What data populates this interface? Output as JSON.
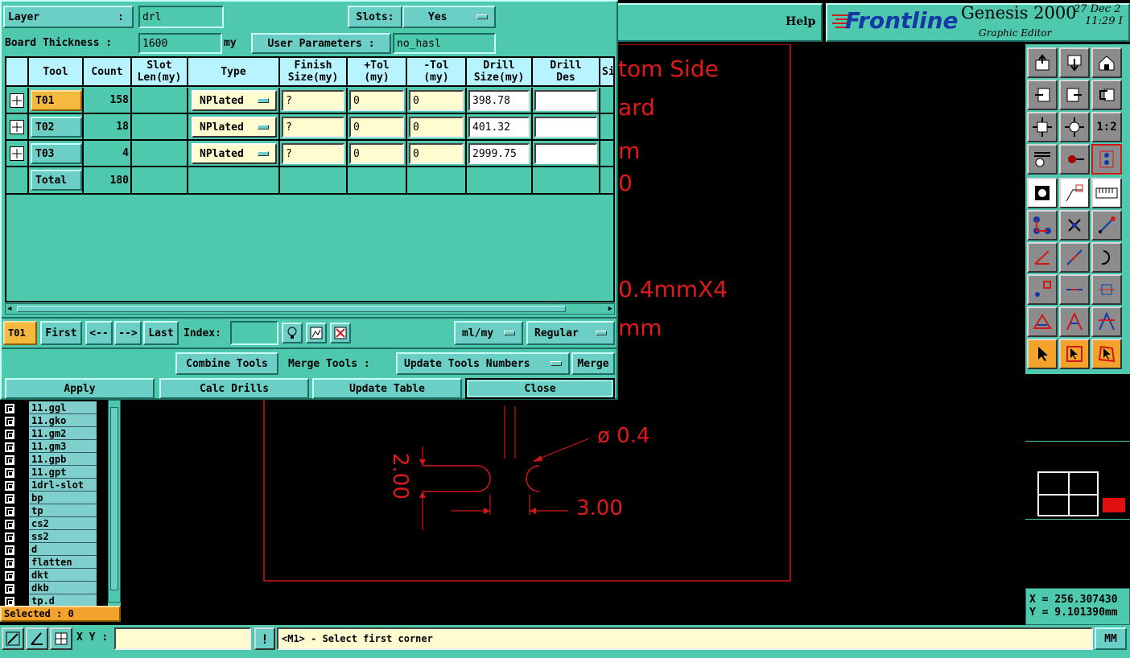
{
  "dialog": {
    "layer_label": "Layer",
    "layer_colon": ":",
    "layer_value": "drl",
    "slots_label": "Slots:",
    "slots_value": "Yes",
    "board_thickness_label": "Board Thickness :",
    "board_thickness_value": "1600",
    "board_thickness_unit": "my",
    "user_params_label": "User Parameters :",
    "user_params_value": "no_hasl",
    "columns": [
      "Tool",
      "Count",
      "Slot\nLen(my)",
      "Type",
      "Finish\nSize(my)",
      "+Tol\n(my)",
      "-Tol\n(my)",
      "Drill\nSize(my)",
      "Drill\nDes",
      "Si"
    ],
    "rows": [
      {
        "tool": "T01",
        "count": "158",
        "type": "NPlated",
        "finish": "?",
        "ptol": "0",
        "mtol": "0",
        "drill": "398.78",
        "des": ""
      },
      {
        "tool": "T02",
        "count": "18",
        "type": "NPlated",
        "finish": "?",
        "ptol": "0",
        "mtol": "0",
        "drill": "401.32",
        "des": ""
      },
      {
        "tool": "T03",
        "count": "4",
        "type": "NPlated",
        "finish": "?",
        "ptol": "0",
        "mtol": "0",
        "drill": "2999.75",
        "des": ""
      }
    ],
    "total_label": "Total",
    "total_count": "180",
    "nav": {
      "current": "T01",
      "first": "First",
      "prev": "<--",
      "next": "-->",
      "last": "Last",
      "index_label": "Index:",
      "units": "ml/my",
      "mode": "Regular"
    },
    "combine_tools": "Combine Tools",
    "merge_tools_label": "Merge Tools :",
    "update_tools_numbers": "Update Tools Numbers",
    "merge": "Merge",
    "apply": "Apply",
    "calc_drills": "Calc Drills",
    "update_table": "Update Table",
    "close": "Close"
  },
  "header": {
    "help": "Help",
    "brand": "Frontline",
    "product": "Genesis 2000",
    "subtitle": "Graphic Editor",
    "date": "27 Dec 2",
    "time": "11:29 I"
  },
  "canvas_text": {
    "line1": "tom Side",
    "line2": "ard",
    "line3": "m",
    "line4": "0",
    "line5": "0.4mmX4",
    "line6": "mm",
    "dia": "ø 0.4",
    "dim_v": "2.00",
    "dim_h": "3.00"
  },
  "layers": [
    "11.ggl",
    "11.gko",
    "11.gm2",
    "11.gm3",
    "11.gpb",
    "11.gpt",
    "1drl-slot",
    "bp",
    "tp",
    "cs2",
    "ss2",
    "d",
    "flatten",
    "dkt",
    "dkb",
    "tp.d"
  ],
  "selected": "Selected : 0",
  "coords": {
    "x": "X = 256.307430",
    "y": "Y = 9.101390mm"
  },
  "status": {
    "xy_label": "X Y :",
    "message": "<M1> - Select first corner",
    "units": "MM"
  },
  "colors": {
    "panel": "#4fc9ae",
    "button": "#6ccfc5",
    "accent": "#f3a22c",
    "drawing": "#e01a1a"
  }
}
